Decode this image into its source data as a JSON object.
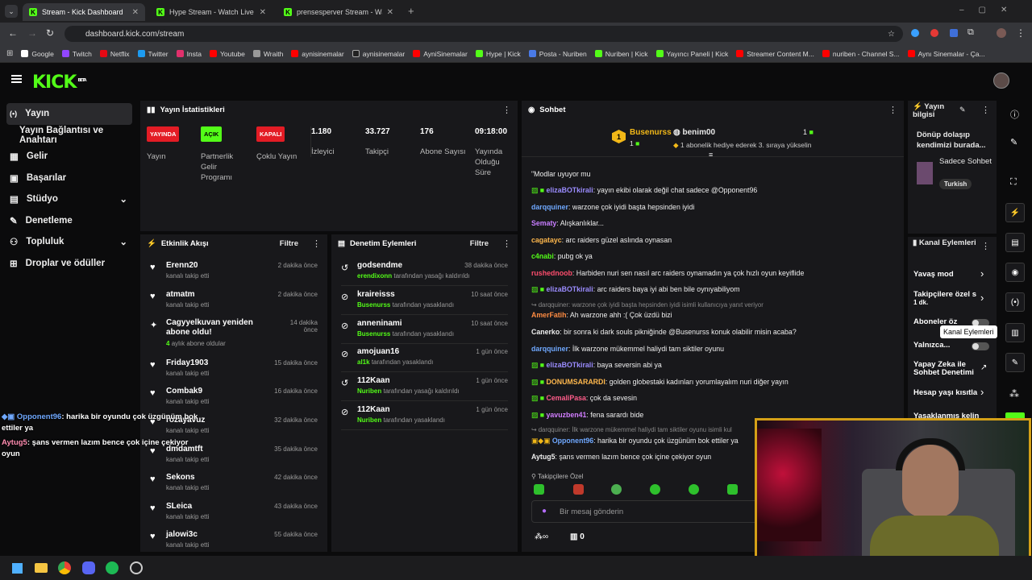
{
  "browser": {
    "tabs": [
      "Stream - Kick Dashboard",
      "Hype Stream - Watch Live on K",
      "prensesperver Stream - Watch"
    ],
    "url": "dashboard.kick.com/stream",
    "bookmarks": [
      "Google",
      "Twitch",
      "Netflix",
      "Twitter",
      "Insta",
      "Youtube",
      "Wraith",
      "aynisinemalar",
      "aynisinemalar",
      "AyniSinemalar",
      "Hype | Kick",
      "Posta - Nuriben",
      "Nuriben | Kick",
      "Yayıncı Paneli | Kick",
      "Streamer Content M...",
      "nuriben - Channel S...",
      "Aynı Sinemalar - Ça..."
    ]
  },
  "brand": {
    "logo": "KICK",
    "beta": "BETA",
    "accent": "#53fc18"
  },
  "sidebar": {
    "items": [
      "Yayın",
      "Yayın Bağlantısı ve Anahtarı",
      "Gelir",
      "Başarılar",
      "Stüdyo",
      "Denetleme",
      "Topluluk",
      "Droplar ve ödüller"
    ]
  },
  "stats": {
    "title": "Yayın İstatistikleri",
    "badges": [
      {
        "text": "YAYINDA",
        "label": "Yayın"
      },
      {
        "text": "AÇIK",
        "label": "Partnerlik Gelir Programı"
      },
      {
        "text": "KAPALI",
        "label": "Çoklu Yayın"
      }
    ],
    "values": [
      {
        "value": "1.180",
        "label": "İzleyici"
      },
      {
        "value": "33.727",
        "label": "Takipçi"
      },
      {
        "value": "176",
        "label": "Abone Sayısı"
      },
      {
        "value": "09:18:00",
        "label": "Yayında Olduğu Süre"
      }
    ]
  },
  "activity": {
    "title": "Etkinlik Akışı",
    "filter": "Filtre",
    "items": [
      {
        "name": "Erenn20",
        "sub": "kanalı takip etti",
        "time": "2 dakika önce"
      },
      {
        "name": "atmatm",
        "sub": "kanalı takip etti",
        "time": "2 dakika önce"
      },
      {
        "name": "Cagyyelkuvan yeniden abone oldu!",
        "sub": "aylık abone oldular",
        "count": "4",
        "time": "14 dakika önce"
      },
      {
        "name": "Friday1903",
        "sub": "kanalı takip etti",
        "time": "15 dakika önce"
      },
      {
        "name": "Combak9",
        "sub": "kanalı takip etti",
        "time": "16 dakika önce"
      },
      {
        "name": "rozayavuz",
        "sub": "kanalı takip etti",
        "time": "32 dakika önce"
      },
      {
        "name": "dmdamtft",
        "sub": "kanalı takip etti",
        "time": "35 dakika önce"
      },
      {
        "name": "Sekons",
        "sub": "kanalı takip etti",
        "time": "42 dakika önce"
      },
      {
        "name": "SLeica",
        "sub": "kanalı takip etti",
        "time": "43 dakika önce"
      },
      {
        "name": "jalowi3c",
        "sub": "kanalı takip etti",
        "time": "55 dakika önce"
      }
    ]
  },
  "moderation": {
    "title": "Denetim Eylemleri",
    "filter": "Filtre",
    "items": [
      {
        "name": "godsendme",
        "by": "erendixonn",
        "sub": "tarafından yasağı kaldırıldı",
        "time": "38 dakika önce"
      },
      {
        "name": "kraireisss",
        "by": "Busenurss",
        "sub": "tarafından yasaklandı",
        "time": "10 saat önce"
      },
      {
        "name": "anneninami",
        "by": "Busenurss",
        "sub": "tarafından yasaklandı",
        "time": "10 saat önce"
      },
      {
        "name": "amojuan16",
        "by": "al1k",
        "sub": "tarafından yasaklandı",
        "time": "1 gün önce"
      },
      {
        "name": "112Kaan",
        "by": "Nuriben",
        "sub": "tarafından yasağı kaldırıldı",
        "time": "1 gün önce"
      },
      {
        "name": "112Kaan",
        "by": "Nuriben",
        "sub": "tarafından yasaklandı",
        "time": "1 gün önce"
      }
    ]
  },
  "chat": {
    "title": "Sohbet",
    "pinned": {
      "user": "Busenurss",
      "rank": "1",
      "count": "1",
      "target": "benim00",
      "tcount": "1",
      "desc": "1 abonelik hediye ederek 3. sıraya yükselin"
    },
    "messages": [
      {
        "text": "\"Modlar uyuyor mu"
      },
      {
        "user": "elizaBOTkirali",
        "color": "#9b8cff",
        "text": ": yayın ekibi olarak değil chat sadece @Opponent96"
      },
      {
        "user": "darqquiner",
        "color": "#6fa8ff",
        "text": ": warzone çok iyidi başta hepsinden iyidi"
      },
      {
        "user": "Sematy",
        "color": "#c77dff",
        "text": ": Alışkanlıklar..."
      },
      {
        "user": "cagatayc",
        "color": "#ffb84d",
        "text": ": arc raiders güzel aslında oynasan"
      },
      {
        "user": "c4nabi",
        "color": "#53fc18",
        "text": ": pubg ok ya"
      },
      {
        "user": "rushednoob",
        "color": "#ff4d6d",
        "text": ": Harbiden nuri sen nasıl arc raiders oynamadın ya çok hızlı oyun keyiflide"
      },
      {
        "user": "elizaBOTkirali",
        "color": "#9b8cff",
        "text": ": arc raiders baya iyi abi ben bile oynıyabiliyom"
      },
      {
        "reply": "darqquiner: warzone çok iyidi başta hepsinden iyidi isimli kullanıcıya yanıt veriyor"
      },
      {
        "user": "AmerFatih",
        "color": "#ff8c42",
        "text": ": Ah warzone ahh :( Çok üzdü bizi"
      },
      {
        "user": "Canerko",
        "color": "#eeeeee",
        "text": ": bir sonra ki dark souls pikniğinde @Busenurss konuk olabilir misin acaba?"
      },
      {
        "user": "darqquiner",
        "color": "#6fa8ff",
        "text": ": İlk warzone mükemmel haliydi tam siktiler oyunu"
      },
      {
        "user": "elizaBOTkirali",
        "color": "#9b8cff",
        "text": ": baya seversin abi ya"
      },
      {
        "user": "DONUMSARARDI",
        "color": "#ffb84d",
        "text": ": golden globestaki kadınları yorumlayalım nuri diğer yayın"
      },
      {
        "user": "CemaliPasa",
        "color": "#ff5c8a",
        "text": ": çok da sevesin"
      },
      {
        "user": "yavuzben41",
        "color": "#d17dff",
        "text": ": fena sarardı bide"
      },
      {
        "reply": "darqquiner: İlk warzone mükemmel haliydi tam siktiler oyunu isimli kul"
      },
      {
        "user": "Opponent96",
        "color": "#6fa8ff",
        "text": ": harika bir oyundu çok üzgünüm bok ettiler ya"
      },
      {
        "user": "Aytug5",
        "color": "#eeeeee",
        "text": ": şans vermen lazım bence çok içine çekiyor oyun"
      }
    ],
    "followers_only": "Takipçilere Özel",
    "placeholder": "Bir mesaj gönderin",
    "viewers_count": "0"
  },
  "overlay": [
    {
      "user": "Opponent96",
      "text": ": harika bir oyundu çok üzgünüm bok ettiler ya"
    },
    {
      "user": "Aytug5",
      "text": ": şans vermen lazım bence çok içine çekiyor oyun"
    }
  ],
  "stream_info": {
    "title": "Yayın bilgisi",
    "desc": "Dönüp dolaşıp kendimizi burada...",
    "mode": "Sadece Sohbet",
    "lang": "Turkish"
  },
  "channel_actions": {
    "title": "Kanal Eylemleri",
    "items": [
      "Yavaş mod",
      "Takipçilere özel s",
      "Aboneler öz",
      "Yalnızca...",
      "Yapay Zeka ile Sohbet Denetimi",
      "Hesap yaşı kısıtla",
      "Yasaklanmış kelin"
    ],
    "followers_sub": "1 dk.",
    "tooltip": "Kanal Eylemleri"
  }
}
